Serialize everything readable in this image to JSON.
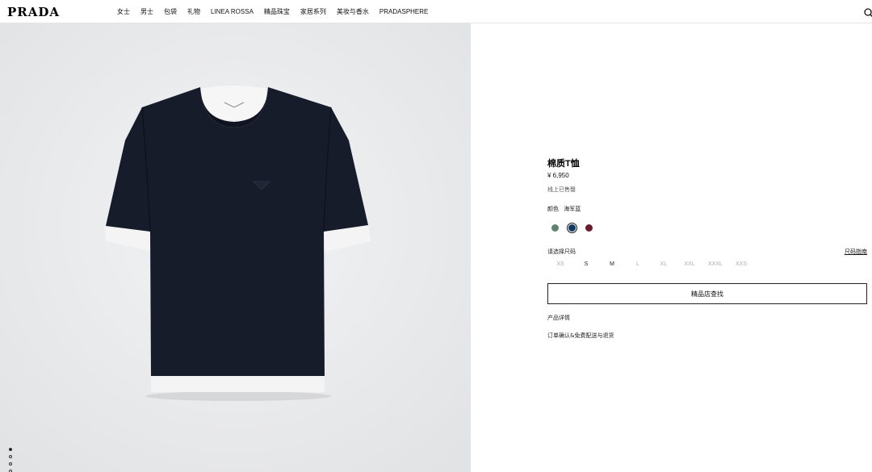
{
  "header": {
    "logo": "PRADA",
    "nav": [
      "女士",
      "男士",
      "包袋",
      "礼物",
      "LINEA ROSSA",
      "精品珠宝",
      "家居系列",
      "美妆与香水",
      "PRADASPHERE"
    ],
    "search_icon": "search-icon"
  },
  "gallery": {
    "image_alt": "navy-tshirt-image",
    "pagination": {
      "count": 5,
      "active": 1
    }
  },
  "product": {
    "title": "棉质T恤",
    "price": "¥ 6,950",
    "availability": "线上已售罄",
    "color_label": "颜色",
    "color_value": "海军蓝",
    "swatches": [
      "#5f8270",
      "#123a66",
      "#6a1a2a"
    ],
    "selected_swatch": 1,
    "size_label": "请选择尺码",
    "size_guide": "尺码指南",
    "sizes": [
      "XS",
      "S",
      "M",
      "L",
      "XL",
      "XXL",
      "XXXL",
      "XXS"
    ],
    "available_sizes": [
      "S",
      "M"
    ],
    "store_button": "精品店查找",
    "details_link": "产品详情",
    "order_info": "订单确认&免费配送与退货"
  }
}
